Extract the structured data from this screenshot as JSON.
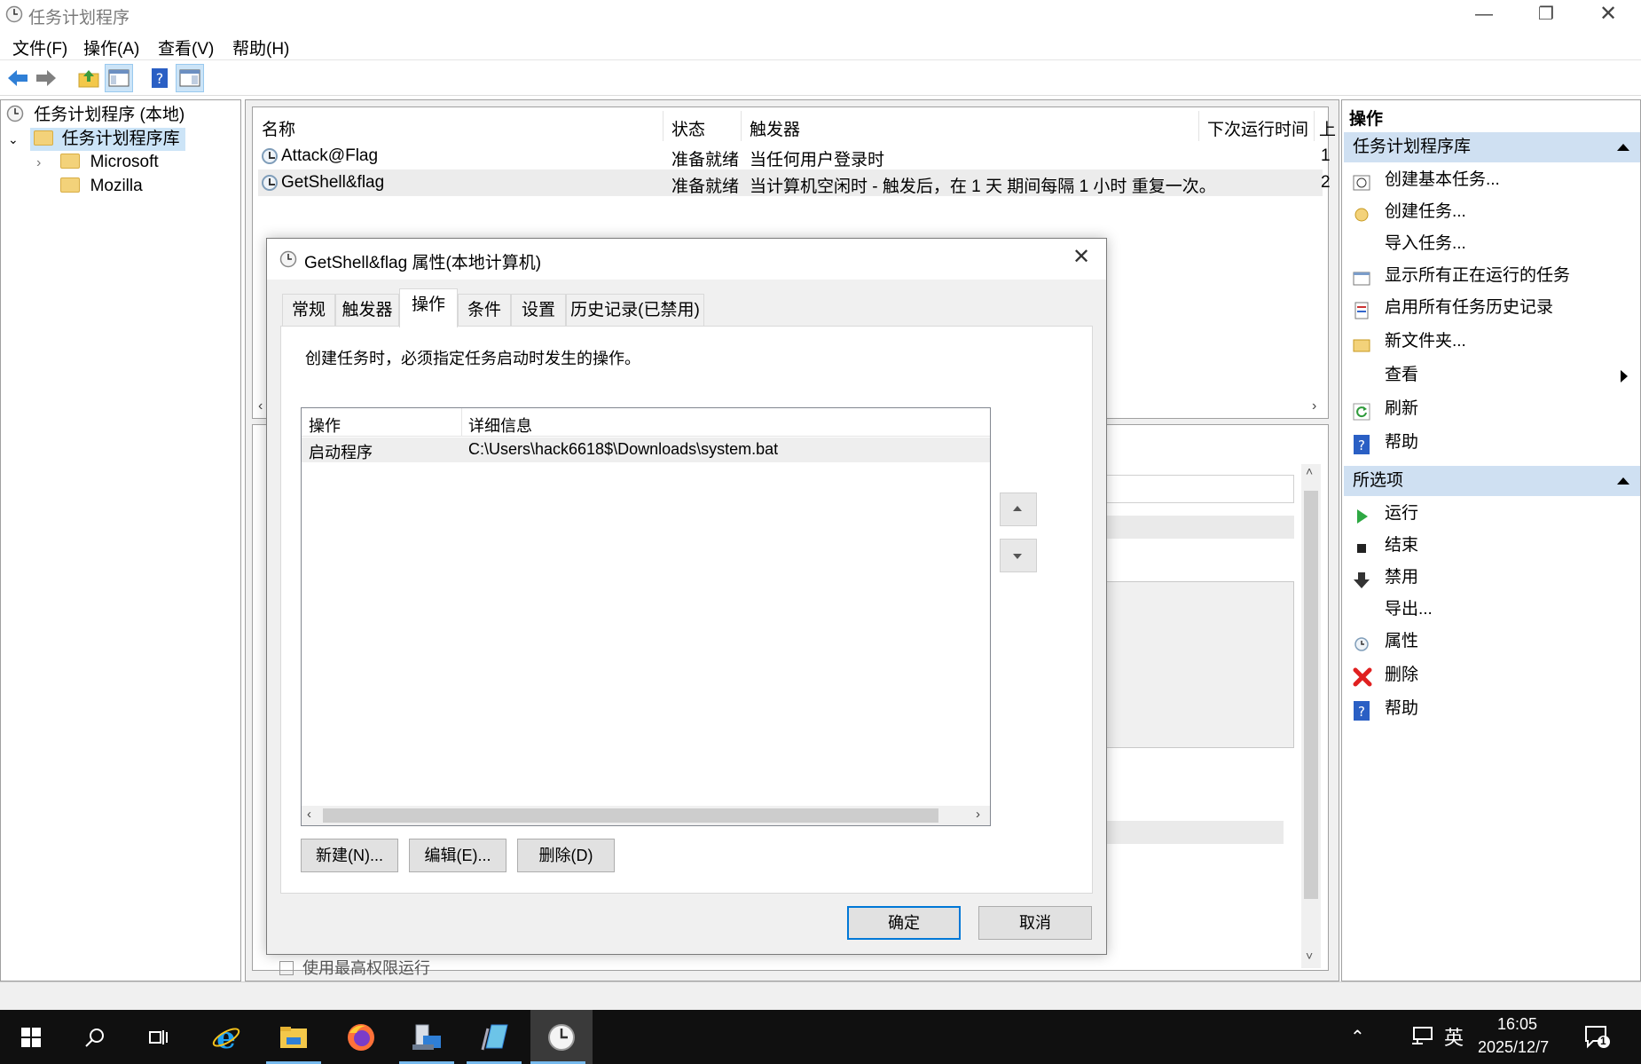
{
  "window": {
    "title": "任务计划程序"
  },
  "menu": [
    "文件(F)",
    "操作(A)",
    "查看(V)",
    "帮助(H)"
  ],
  "tree": {
    "root": "任务计划程序 (本地)",
    "library": "任务计划程序库",
    "folders": [
      "Microsoft",
      "Mozilla"
    ]
  },
  "tasklist": {
    "columns": [
      "名称",
      "状态",
      "触发器",
      "下次运行时间",
      "上"
    ],
    "rows": [
      {
        "name": "Attack@Flag",
        "status": "准备就绪",
        "trigger": "当任何用户登录时",
        "next": "1"
      },
      {
        "name": "GetShell&flag",
        "status": "准备就绪",
        "trigger": "当计算机空闲时 - 触发后，在 1 天 期间每隔 1 小时 重复一次。",
        "next": "2"
      }
    ]
  },
  "detail": {
    "partial_checkbox_label": "使用最高权限运行"
  },
  "actions": {
    "header": "操作",
    "section1": {
      "title": "任务计划程序库",
      "items": [
        "创建基本任务...",
        "创建任务...",
        "导入任务...",
        "显示所有正在运行的任务",
        "启用所有任务历史记录",
        "新文件夹...",
        "查看",
        "刷新",
        "帮助"
      ]
    },
    "section2": {
      "title": "所选项",
      "items": [
        "运行",
        "结束",
        "禁用",
        "导出...",
        "属性",
        "删除",
        "帮助"
      ]
    }
  },
  "dialog": {
    "title": "GetShell&flag 属性(本地计算机)",
    "tabs": [
      "常规",
      "触发器",
      "操作",
      "条件",
      "设置",
      "历史记录(已禁用)"
    ],
    "active_tab": "操作",
    "description": "创建任务时，必须指定任务启动时发生的操作。",
    "list_columns": [
      "操作",
      "详细信息"
    ],
    "list_rows": [
      {
        "action": "启动程序",
        "details": "C:\\Users\\hack6618$\\Downloads\\system.bat"
      }
    ],
    "buttons": {
      "new": "新建(N)...",
      "edit": "编辑(E)...",
      "delete": "删除(D)",
      "ok": "确定",
      "cancel": "取消"
    }
  },
  "taskbar": {
    "time": "16:05",
    "date": "2025/12/7",
    "ime": "英",
    "notification_count": "1"
  },
  "colors": {
    "selection_header": "#cfe0f2",
    "taskbar": "#101010",
    "accent": "#0078d7"
  }
}
